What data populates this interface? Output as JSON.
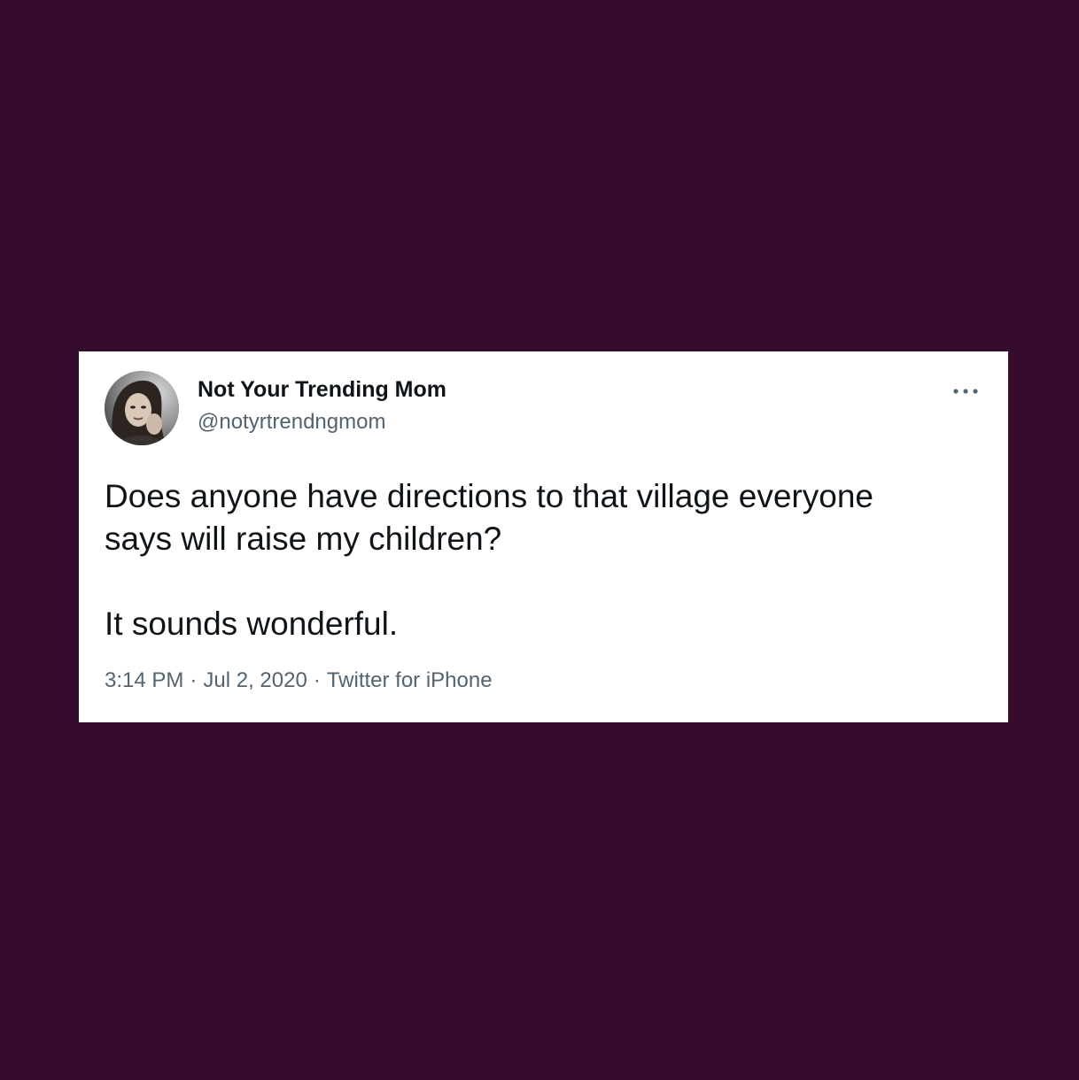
{
  "colors": {
    "background": "#350c2b",
    "card": "#ffffff",
    "primary_text": "#0f1419",
    "secondary_text": "#536471"
  },
  "tweet": {
    "author": {
      "display_name": "Not Your Trending Mom",
      "handle": "@notyrtrendngmom",
      "avatar_icon": "profile-photo"
    },
    "more_icon": "more-options-icon",
    "text": "Does anyone have directions to that village everyone\nsays will raise my children?\n\nIt sounds wonderful.",
    "time": "3:14 PM",
    "date": "Jul 2, 2020",
    "source": "Twitter for iPhone",
    "separator": "·"
  }
}
